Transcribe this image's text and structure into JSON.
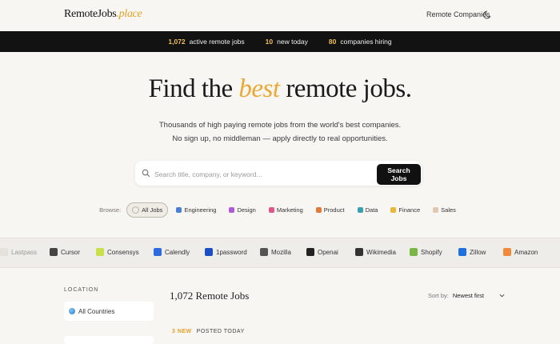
{
  "nav": {
    "logo_main": "RemoteJobs",
    "logo_accent": ".place",
    "remote_companies": "Remote Companies"
  },
  "ticker": [
    {
      "num": "1,072",
      "label": "active remote jobs"
    },
    {
      "num": "10",
      "label": "new today"
    },
    {
      "num": "80",
      "label": "companies hiring"
    }
  ],
  "hero": {
    "title_pre": "Find the ",
    "title_accent": "best",
    "title_post": " remote jobs.",
    "subtitle_line1": "Thousands of high paying remote jobs from the world's best companies.",
    "subtitle_line2": "No sign up, no middleman — apply directly to real opportunities."
  },
  "search": {
    "placeholder": "Search title, company, or keyword...",
    "value": "",
    "button": "Search Jobs"
  },
  "browse": {
    "label": "Browse:",
    "categories": [
      {
        "label": "All Jobs",
        "color": "#b9b4aa",
        "active": true
      },
      {
        "label": "Engineering",
        "color": "#4a7fd6"
      },
      {
        "label": "Design",
        "color": "#b05ad8"
      },
      {
        "label": "Marketing",
        "color": "#e0568a"
      },
      {
        "label": "Product",
        "color": "#e07a3a"
      },
      {
        "label": "Data",
        "color": "#3aa0b0"
      },
      {
        "label": "Finance",
        "color": "#e8b83a"
      },
      {
        "label": "Sales",
        "color": "#e0c8b0"
      }
    ]
  },
  "companies": [
    {
      "name": "Lastpass",
      "color": "#d9d5cf",
      "faded": true
    },
    {
      "name": "Cursor",
      "color": "#444444"
    },
    {
      "name": "Consensys",
      "color": "#c9e04a"
    },
    {
      "name": "Calendly",
      "color": "#2f6be0"
    },
    {
      "name": "1password",
      "color": "#1d4fc4"
    },
    {
      "name": "Mozilla",
      "color": "#555555"
    },
    {
      "name": "Openai",
      "color": "#222222"
    },
    {
      "name": "Wikimedia",
      "color": "#333333"
    },
    {
      "name": "Shopify",
      "color": "#7ab648"
    },
    {
      "name": "Zillow",
      "color": "#1f6fe0"
    },
    {
      "name": "Amazon",
      "color": "#f08a3a"
    }
  ],
  "sidebar": {
    "location_label": "LOCATION",
    "location_value": "All Countries"
  },
  "listing": {
    "count": "1,072 Remote Jobs",
    "sort_label": "Sort by:",
    "sort_value": "Newest first",
    "new_badge": "3 NEW",
    "posted_today": "POSTED TODAY"
  }
}
